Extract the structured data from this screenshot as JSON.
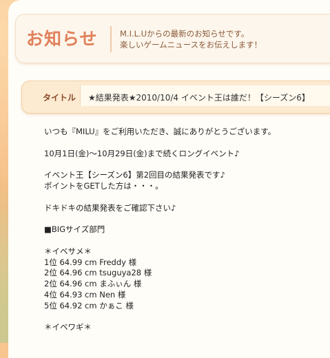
{
  "header": {
    "title": "お知らせ",
    "desc_line1": "M.I.L.Uからの最新のお知らせです。",
    "desc_line2": "楽しいゲームニュースをお伝えします！"
  },
  "notice": {
    "title_label": "タイトル",
    "title_text": "★結果発表★2010/10/4 イベント王は誰だ！【シーズン6】"
  },
  "body": {
    "lines": [
      "いつも『MILU』をご利用いただき、誠にありがとうございます。",
      "",
      "10月1日(金)～10月29日(金)まで続くロングイベント♪",
      "",
      "イベント王【シーズン6】第2回目の結果発表です♪",
      "ポイントをGETした方は・・・。",
      "",
      "ドキドキの結果発表をご確認下さい♪",
      "",
      "■BIGサイズ部門",
      "",
      "＊イベサメ＊",
      "1位 64.99 cm Freddy 様",
      "2位 64.96 cm tsuguya28 様",
      "2位 64.96 cm まふぃん 様",
      "4位 64.93 cm Nen 様",
      "5位 64.92 cm かぁこ 様",
      "",
      "＊イベワギ＊"
    ]
  }
}
